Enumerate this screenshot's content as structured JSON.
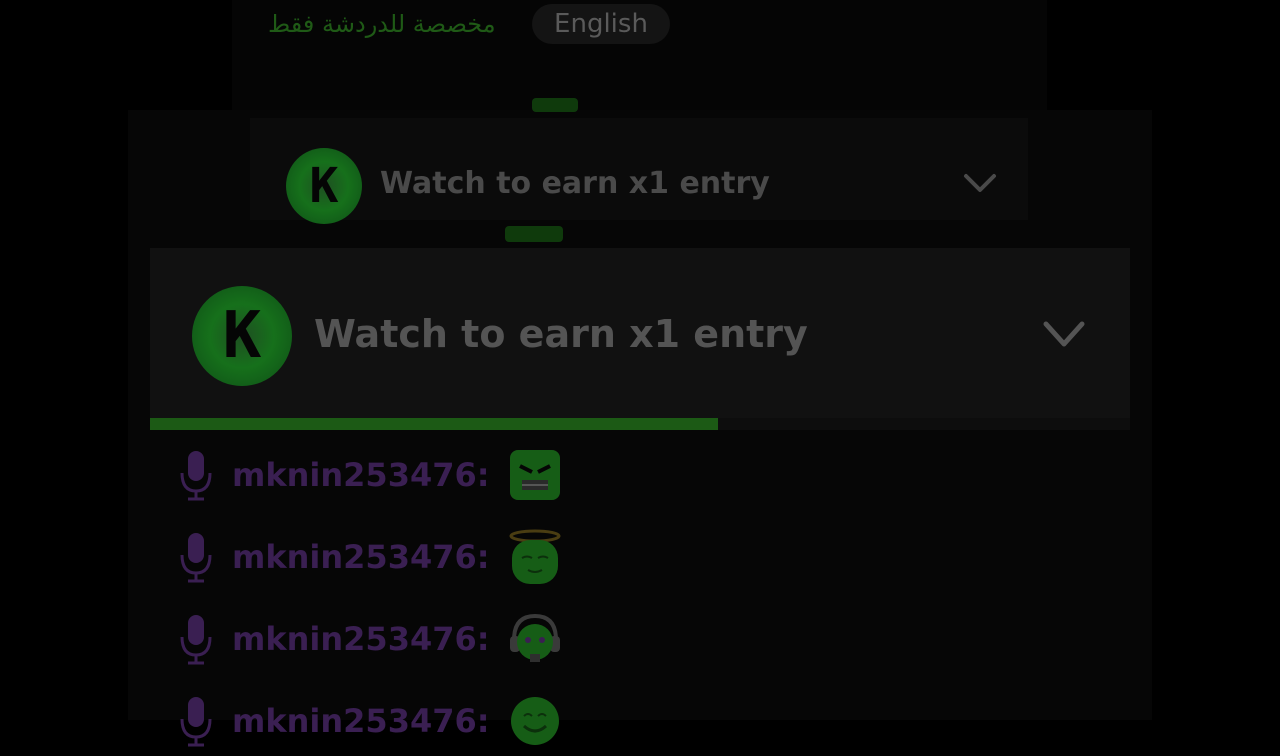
{
  "header": {
    "arabic_note": "مخصصة للدردشة فقط",
    "language_label": "English"
  },
  "reward_panel_small": {
    "badge_letter": "K",
    "title": "Watch to earn x1 entry"
  },
  "reward_panel_large": {
    "badge_letter": "K",
    "title": "Watch to earn x1 entry",
    "progress_fraction": 0.58
  },
  "chat": {
    "messages": [
      {
        "username": "mknin253476",
        "separator": ":",
        "emote": "angry-face-emote"
      },
      {
        "username": "mknin253476",
        "separator": ":",
        "emote": "halo-face-emote"
      },
      {
        "username": "mknin253476",
        "separator": ":",
        "emote": "headphones-face-emote"
      },
      {
        "username": "mknin253476",
        "separator": ":",
        "emote": "smile-face-emote"
      }
    ]
  },
  "colors": {
    "accent_green": "#1c5a15",
    "username_purple": "#3a1f52"
  }
}
